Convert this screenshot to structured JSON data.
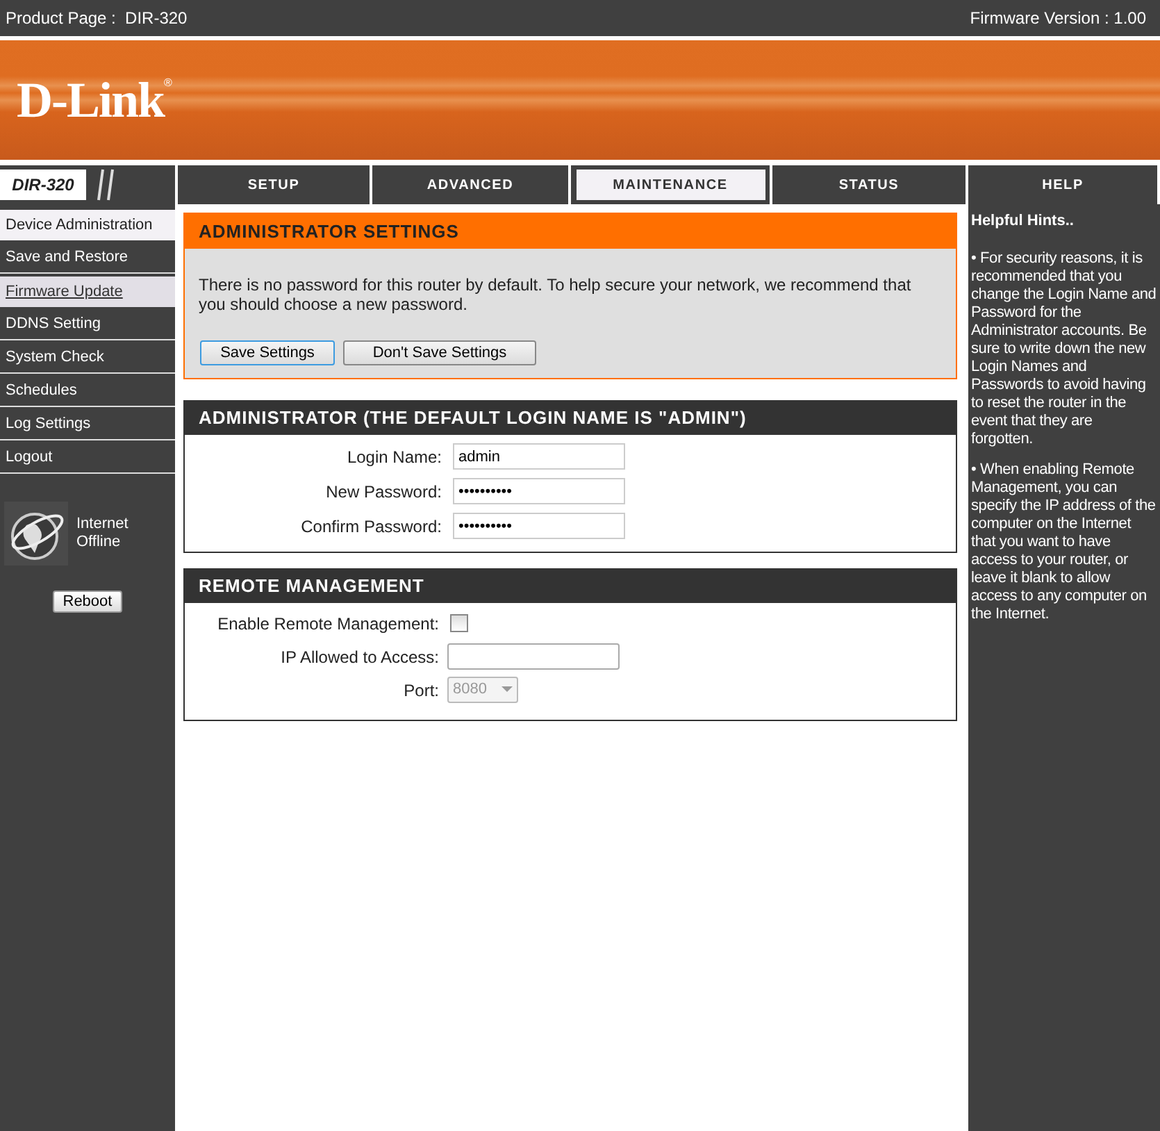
{
  "top_bar": {
    "product": "Product Page :  DIR-320",
    "firmware": "Firmware Version : 1.00"
  },
  "banner": {
    "logo": "D-Link",
    "logo_mark": "®"
  },
  "model_tab": "DIR-320",
  "tabs": [
    {
      "label": "SETUP",
      "selected": false
    },
    {
      "label": "ADVANCED",
      "selected": false
    },
    {
      "label": "MAINTENANCE",
      "selected": true
    },
    {
      "label": "STATUS",
      "selected": false
    },
    {
      "label": "HELP",
      "selected": false
    }
  ],
  "sidebar": {
    "items": [
      {
        "label": "Device Administration",
        "selected": true,
        "hovered": false
      },
      {
        "label": "Save and Restore",
        "selected": false,
        "hovered": false
      },
      {
        "label": "Firmware Update",
        "selected": false,
        "hovered": true
      },
      {
        "label": "DDNS Setting",
        "selected": false,
        "hovered": false
      },
      {
        "label": "System Check",
        "selected": false,
        "hovered": false
      },
      {
        "label": "Schedules",
        "selected": false,
        "hovered": false
      },
      {
        "label": "Log Settings",
        "selected": false,
        "hovered": false
      },
      {
        "label": "Logout",
        "selected": false,
        "hovered": false
      }
    ],
    "status": [
      "Internet",
      "Offline"
    ],
    "reboot": "Reboot"
  },
  "settings": {
    "title": "ADMINISTRATOR SETTINGS",
    "text": "There is no password for this router by default. To help secure your network, we recommend that you should choose a new password.",
    "buttons": [
      {
        "label": "Save Settings",
        "focused": true
      },
      {
        "label": "Don't Save Settings",
        "focused": false
      }
    ]
  },
  "admin": {
    "title": "ADMINISTRATOR (THE DEFAULT LOGIN NAME IS \"ADMIN\")",
    "fields": [
      {
        "label": "Login Name:",
        "value": "admin"
      },
      {
        "label": "New Password:",
        "value": "••••••••••"
      },
      {
        "label": "Confirm Password:",
        "value": "••••••••••"
      }
    ]
  },
  "remote": {
    "title": "REMOTE MANAGEMENT",
    "rows": [
      {
        "kind": "checkbox",
        "label": "Enable Remote Management:",
        "checked": false
      },
      {
        "kind": "text",
        "label": "IP Allowed to Access:"
      },
      {
        "kind": "select",
        "label": "Port:",
        "value": "8080",
        "disabled": true
      }
    ]
  },
  "help": {
    "title": "Helpful Hints..",
    "hints": [
      "• For security reasons, it is recommended that you change the Login Name and Password for the Administrator accounts. Be sure to write down the new Login Names and Passwords to avoid having to reset the router in the event that they are forgotten.",
      "• When enabling Remote Management, you can specify the IP address of the computer on the Internet that you want to have access to your router, or leave it blank to allow access to any computer on the Internet."
    ]
  }
}
